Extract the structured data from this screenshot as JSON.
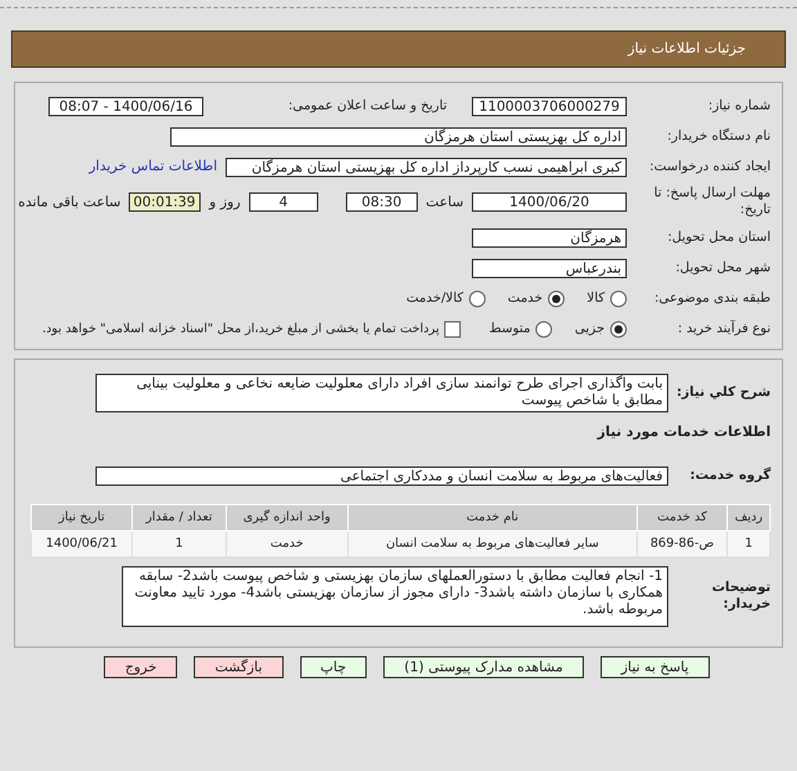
{
  "header": {
    "title": "جزئیات اطلاعات نیاز"
  },
  "details": {
    "need_number": {
      "label": "شماره نیاز:",
      "value": "1100003706000279"
    },
    "announce_date": {
      "label": "تاریخ و ساعت اعلان عمومی:",
      "value": "1400/06/16 - 08:07"
    },
    "buyer": {
      "label": "نام دستگاه خریدار:",
      "value": "اداره کل بهزیستی استان هرمزگان"
    },
    "creator": {
      "label": "ایجاد کننده درخواست:",
      "value": "کبری  ابراهیمی نسب کارپرداز اداره کل بهزیستی استان هرمزگان",
      "link": "اطلاعات تماس خریدار"
    },
    "deadline": {
      "label": "مهلت ارسال پاسخ: تا تاریخ:",
      "date": "1400/06/20",
      "time_label": "ساعت",
      "time": "08:30",
      "days": "4",
      "days_label": "روز و",
      "remaining": "00:01:39",
      "remaining_label": "ساعت باقی مانده"
    },
    "province": {
      "label": "استان محل تحویل:",
      "value": "هرمزگان"
    },
    "city": {
      "label": "شهر محل تحویل:",
      "value": "بندرعباس"
    },
    "category": {
      "label": "طبقه بندی موضوعی:",
      "options": [
        {
          "label": "کالا",
          "selected": false
        },
        {
          "label": "خدمت",
          "selected": true
        },
        {
          "label": "کالا/خدمت",
          "selected": false
        }
      ]
    },
    "process": {
      "label": "نوع فرآیند خرید :",
      "options": [
        {
          "label": "جزیی",
          "selected": true
        },
        {
          "label": "متوسط",
          "selected": false
        }
      ],
      "payment": {
        "label": "پرداخت تمام یا بخشی از مبلغ خرید،از محل \"اسناد خزانه اسلامی\" خواهد بود.",
        "checked": false
      }
    }
  },
  "summary": {
    "label": "شرح کلي نياز:",
    "value": "بابت واگذاری اجرای طرح توانمند سازی افراد دارای معلولیت ضایعه نخاعی و معلولیت بینایی مطابق با شاخص پیوست"
  },
  "services_heading": "اطلاعات خدمات مورد نیاز",
  "service_group": {
    "label": "گروه خدمت:",
    "value": "فعالیت‌های مربوط به سلامت انسان و مددکاری اجتماعی"
  },
  "table": {
    "columns": [
      "ردیف",
      "کد خدمت",
      "نام خدمت",
      "واحد اندازه گیری",
      "تعداد / مقدار",
      "تاریخ نیاز"
    ],
    "rows": [
      [
        "1",
        "ص-86-869",
        "سایر فعالیت‌های مربوط به سلامت انسان",
        "خدمت",
        "1",
        "1400/06/21"
      ]
    ]
  },
  "notes": {
    "label": "توضیحات خریدار:",
    "value": "1- انجام فعالیت مطابق با دستورالعملهای سازمان بهزیستی و شاخص پیوست باشد2- سابقه همکاری با سازمان داشته باشد3- دارای مجوز از سازمان بهزیستی باشد4- مورد تایید معاونت مربوطه باشد."
  },
  "buttons": [
    {
      "label": "پاسخ به نیاز",
      "kind": "primary"
    },
    {
      "label": "مشاهده مدارک پیوستی (1)",
      "kind": "primary"
    },
    {
      "label": "چاپ",
      "kind": "primary"
    },
    {
      "label": "بازگشت",
      "kind": "danger"
    },
    {
      "label": "خروج",
      "kind": "danger"
    }
  ]
}
